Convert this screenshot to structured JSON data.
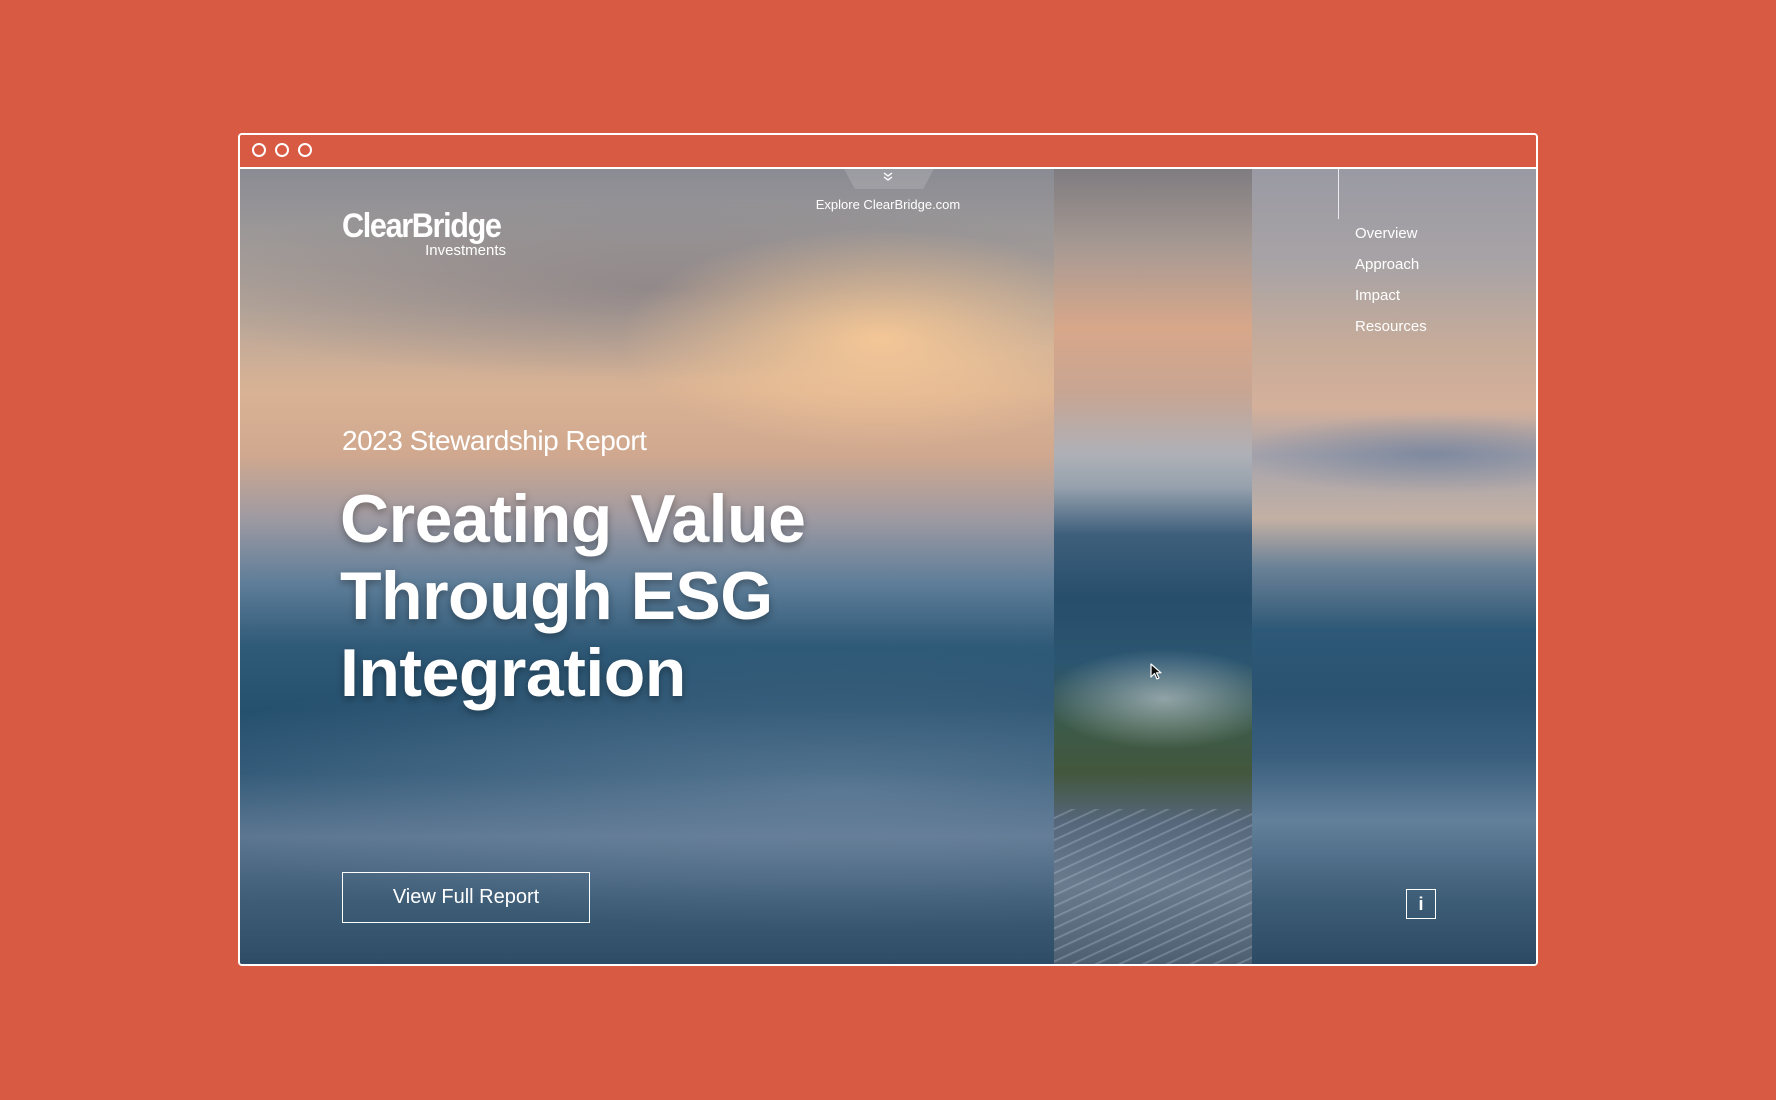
{
  "window": {
    "controls": [
      "close",
      "minimize",
      "maximize"
    ]
  },
  "header": {
    "explore_link": "Explore ClearBridge.com",
    "explore_icon": "double-chevron-down-icon",
    "logo": {
      "name": "ClearBridge",
      "sub": "Investments"
    }
  },
  "nav": {
    "items": [
      "Overview",
      "Approach",
      "Impact",
      "Resources"
    ]
  },
  "hero": {
    "subtitle": "2023 Stewardship Report",
    "headline_lines": [
      "Creating Value",
      "Through ESG",
      "Integration"
    ],
    "cta_label": "View Full Report",
    "info_label": "i"
  },
  "colors": {
    "background": "#d85a43",
    "frame": "#ffffff",
    "text": "#ffffff"
  }
}
